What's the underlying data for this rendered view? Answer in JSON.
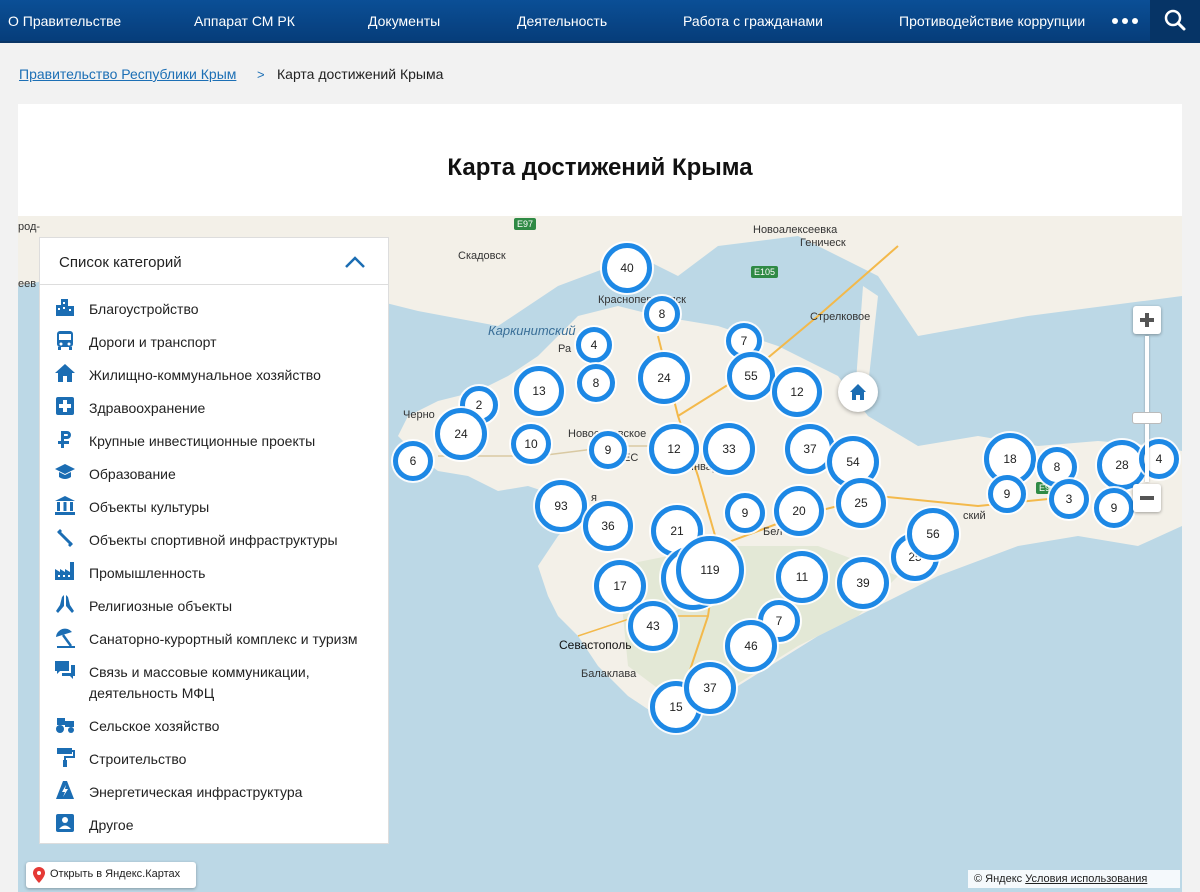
{
  "nav": {
    "items": [
      "О Правительстве",
      "Аппарат СМ РК",
      "Документы",
      "Деятельность",
      "Работа с гражданами",
      "Противодействие коррупции"
    ]
  },
  "breadcrumb": {
    "home": "Правительство Республики Крым",
    "separator": ">",
    "current": "Карта достижений Крыма"
  },
  "page": {
    "title": "Карта достижений Крыма"
  },
  "panel": {
    "title": "Список категорий",
    "categories": [
      {
        "label": "Благоустройство",
        "icon": "city-buildings-icon"
      },
      {
        "label": "Дороги и транспорт",
        "icon": "bus-icon"
      },
      {
        "label": "Жилищно-коммунальное хозяйство",
        "icon": "house-icon"
      },
      {
        "label": "Здравоохранение",
        "icon": "medical-cross-icon"
      },
      {
        "label": "Крупные инвестиционные проекты",
        "icon": "ruble-icon"
      },
      {
        "label": "Образование",
        "icon": "graduation-cap-icon"
      },
      {
        "label": "Объекты культуры",
        "icon": "museum-icon"
      },
      {
        "label": "Объекты спортивной инфраструктуры",
        "icon": "dumbbell-icon"
      },
      {
        "label": "Промышленность",
        "icon": "factory-icon"
      },
      {
        "label": "Религиозные объекты",
        "icon": "praying-hands-icon"
      },
      {
        "label": "Санаторно-курортный комплекс и туризм",
        "icon": "beach-umbrella-icon"
      },
      {
        "label": "Связь и массовые коммуникации,",
        "label2": "деятельность МФЦ",
        "icon": "chat-icon"
      },
      {
        "label": "Сельское хозяйство",
        "icon": "tractor-icon"
      },
      {
        "label": "Строительство",
        "icon": "paint-roller-icon"
      },
      {
        "label": "Энергетическая инфраструктура",
        "icon": "energy-icon"
      },
      {
        "label": "Другое",
        "icon": "person-badge-icon"
      }
    ]
  },
  "map": {
    "labels": {
      "skadovsk": "Скадовск",
      "novoalekseevka": "Новоалексеевка",
      "genichesk": "Геническ",
      "krasnoperekopsk": "Красноперекопск",
      "strelkovoe": "Стрелковое",
      "karkinit": "Каркинитский",
      "razdolnoe": "Ра",
      "chernomorsk": "Черно",
      "novoselovskoe": "Новоселовское",
      "yanvarskoe": "Январское",
      "sevastopol": "Севастополь",
      "balaklava": "Балаклава",
      "sovetsky": "ский",
      "belogorsk": "Бел",
      "rod": "род-",
      "eev": "еев",
      "les": "ЕС",
      "ya": "я"
    },
    "roads": [
      "E97",
      "E105",
      "E97"
    ],
    "clusters": [
      "40",
      "8",
      "4",
      "7",
      "8",
      "24",
      "55",
      "12",
      "13",
      "2",
      "24",
      "10",
      "9",
      "12",
      "33",
      "37",
      "54",
      "6",
      "93",
      "36",
      "21",
      "9",
      "20",
      "25",
      "56",
      "25",
      "119",
      "17",
      "11",
      "39",
      "43",
      "7",
      "46",
      "37",
      "15",
      "18",
      "8",
      "28",
      "4",
      "9",
      "3",
      "9"
    ],
    "open_yandex": "Открыть в Яндекс.Картах",
    "copyright": "© Яндекс",
    "terms": "Условия использования"
  }
}
